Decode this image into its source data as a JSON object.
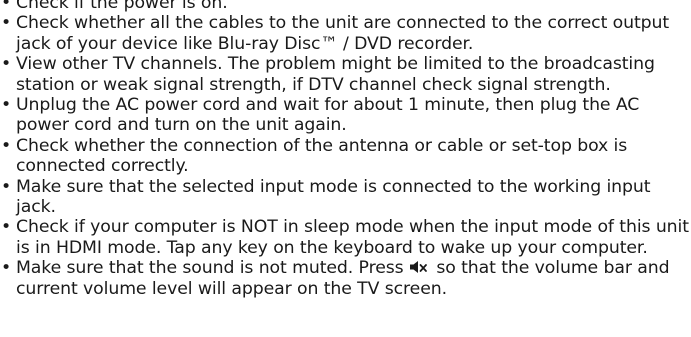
{
  "bullet_glyph": "•",
  "items": [
    {
      "text": "Check if the power is on."
    },
    {
      "text": "Check whether all the cables to the unit are connected to the correct output jack of your device like Blu-ray Disc™ / DVD recorder."
    },
    {
      "text": "View other TV channels. The problem might be limited to the broadcasting station or weak signal strength, if DTV channel check signal strength."
    },
    {
      "text": "Unplug the AC power cord and wait for about 1 minute, then plug the AC power cord and turn on the unit again."
    },
    {
      "text": "Check whether the connection of the antenna or cable or set-top box is connected correctly."
    },
    {
      "text": "Make sure that the selected input mode is connected to the working input jack."
    },
    {
      "text": "Check if your computer is NOT in sleep mode when the input mode of this unit is in HDMI mode. Tap any key on the keyboard to wake up your computer."
    },
    {
      "text_before_icon": "Make sure that the sound is not muted. Press",
      "icon": "mute-speaker-icon",
      "text_after_icon": "so that the volume bar and current volume level will appear on the TV screen."
    }
  ]
}
